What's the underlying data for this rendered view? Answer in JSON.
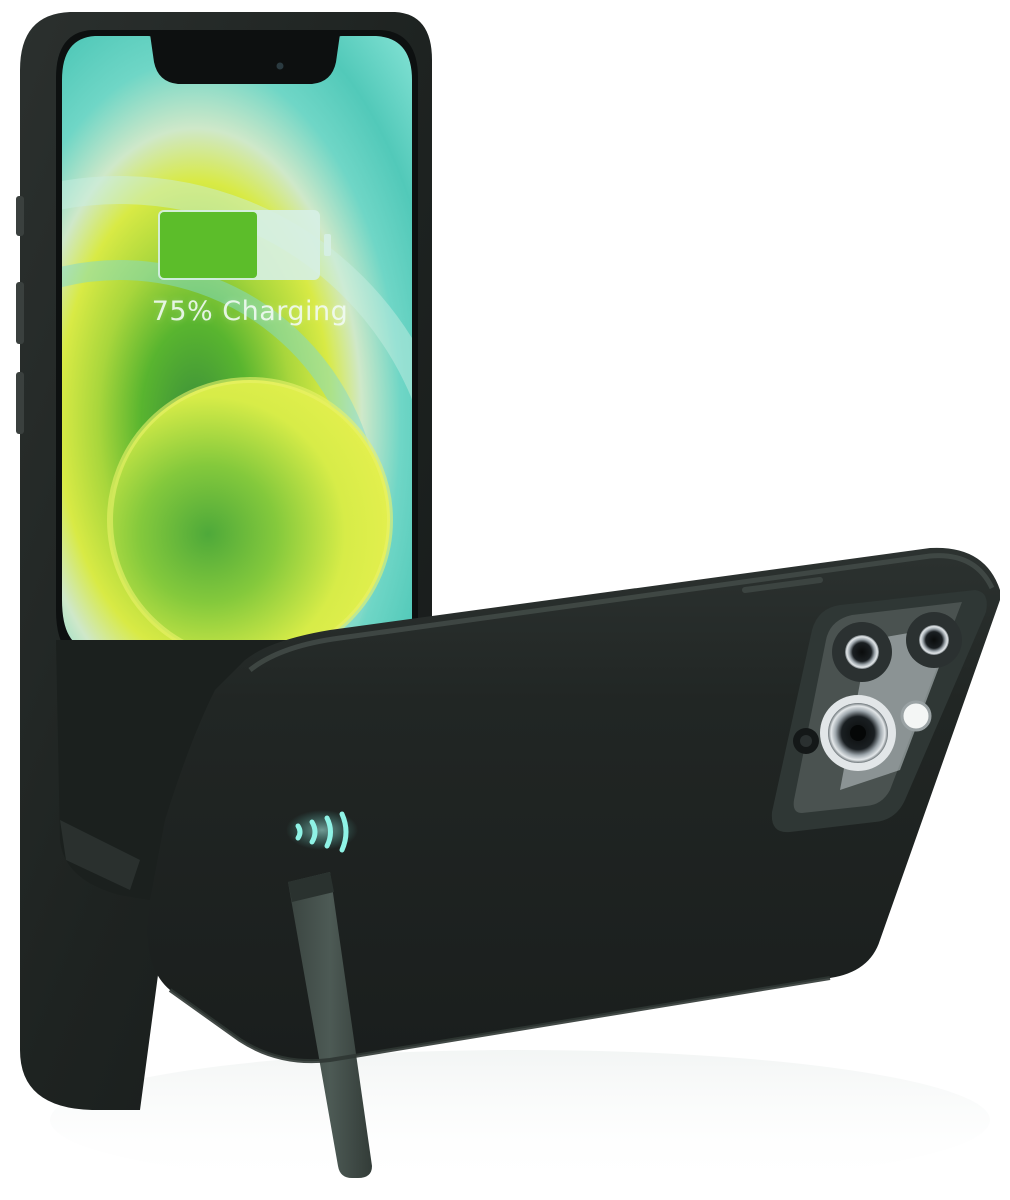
{
  "screen": {
    "battery_label": "75% Charging",
    "battery_level": 0.75
  },
  "colors": {
    "case": "#1f2422",
    "screen_teal": "#56cfbf",
    "screen_lime": "#d9ea3c",
    "battery_fill": "#5cbd2a",
    "led_glow": "#5fe3d6"
  },
  "icons": [
    "battery-icon",
    "camera-lens-icon",
    "flash-icon",
    "led-indicator-icon"
  ]
}
